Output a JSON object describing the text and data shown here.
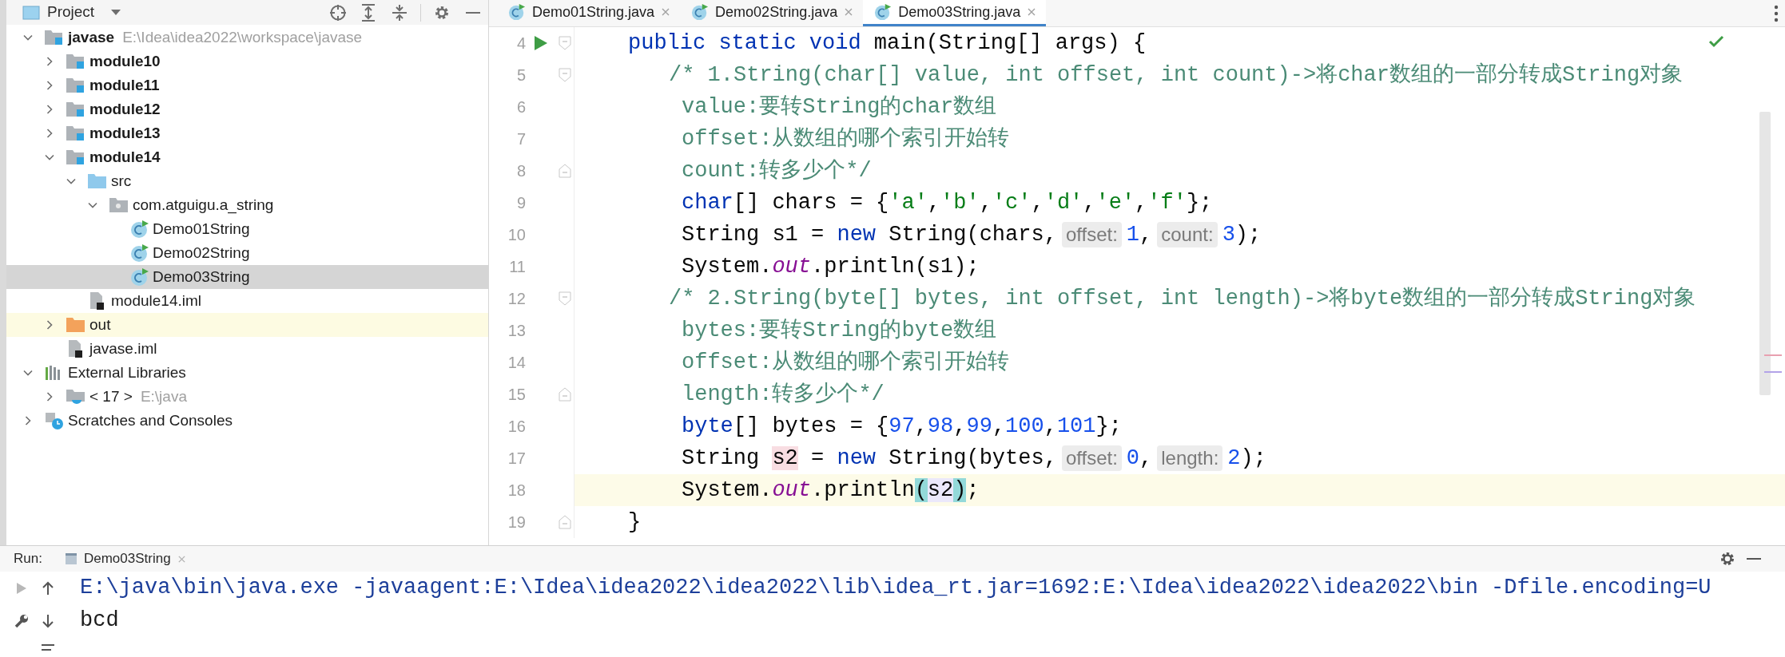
{
  "project": {
    "title": "Project",
    "tree": [
      {
        "label": "javase",
        "path": "E:\\Idea\\idea2022\\workspace\\javase",
        "kind": "module",
        "bold": true,
        "expanded": true,
        "selected": false,
        "ignored": false,
        "children": [
          {
            "label": "module10",
            "kind": "module",
            "bold": true,
            "expanded": false,
            "selected": false,
            "ignored": false
          },
          {
            "label": "module11",
            "kind": "module",
            "bold": true,
            "expanded": false,
            "selected": false,
            "ignored": false
          },
          {
            "label": "module12",
            "kind": "module",
            "bold": true,
            "expanded": false,
            "selected": false,
            "ignored": false
          },
          {
            "label": "module13",
            "kind": "module",
            "bold": true,
            "expanded": false,
            "selected": false,
            "ignored": false
          },
          {
            "label": "module14",
            "kind": "module",
            "bold": true,
            "expanded": true,
            "selected": false,
            "ignored": false,
            "children": [
              {
                "label": "src",
                "kind": "source",
                "bold": false,
                "expanded": true,
                "selected": false,
                "ignored": false,
                "children": [
                  {
                    "label": "com.atguigu.a_string",
                    "kind": "package",
                    "bold": false,
                    "expanded": true,
                    "selected": false,
                    "ignored": false,
                    "children": [
                      {
                        "label": "Demo01String",
                        "kind": "class",
                        "bold": false,
                        "selected": false,
                        "ignored": false
                      },
                      {
                        "label": "Demo02String",
                        "kind": "class",
                        "bold": false,
                        "selected": false,
                        "ignored": false
                      },
                      {
                        "label": "Demo03String",
                        "kind": "class",
                        "bold": false,
                        "selected": true,
                        "ignored": false
                      }
                    ]
                  }
                ]
              },
              {
                "label": "module14.iml",
                "kind": "iml",
                "bold": false,
                "selected": false,
                "ignored": false
              }
            ]
          },
          {
            "label": "out",
            "kind": "excluded",
            "bold": false,
            "expanded": false,
            "selected": false,
            "ignored": true
          },
          {
            "label": "javase.iml",
            "kind": "iml",
            "bold": false,
            "selected": false,
            "ignored": false
          }
        ]
      },
      {
        "label": "External Libraries",
        "kind": "libraries",
        "bold": false,
        "expanded": true,
        "selected": false,
        "ignored": false,
        "children": [
          {
            "label": "< 17 >",
            "path": "E:\\java",
            "kind": "sdk",
            "bold": false,
            "expanded": false,
            "selected": false,
            "ignored": false
          }
        ]
      },
      {
        "label": "Scratches and Consoles",
        "kind": "scratches",
        "bold": false,
        "expanded": false,
        "selected": false,
        "ignored": false
      }
    ]
  },
  "editor": {
    "tabs": [
      {
        "label": "Demo01String.java",
        "selected": false
      },
      {
        "label": "Demo02String.java",
        "selected": false
      },
      {
        "label": "Demo03String.java",
        "selected": true
      }
    ],
    "lines": [
      {
        "number": "4",
        "kind": "signature",
        "run": true,
        "fold_open": true,
        "fold_close": false,
        "current": false,
        "tokens": [
          {
            "kind": "keyword",
            "text": "public static void"
          },
          {
            "kind": "plain",
            "text": " main(String[] args) {"
          }
        ]
      },
      {
        "number": "5",
        "kind": "comment-open",
        "run": false,
        "fold_open": true,
        "fold_close": false,
        "current": false,
        "tokens": [
          {
            "kind": "comment",
            "text": "/* 1.String(char[] value, int offset, int count)->将char数组的一部分转成String对象"
          }
        ]
      },
      {
        "number": "6",
        "kind": "body",
        "run": false,
        "fold_open": false,
        "fold_close": false,
        "current": false,
        "tokens": [
          {
            "kind": "comment",
            "text": "value:要转String的char数组"
          }
        ]
      },
      {
        "number": "7",
        "kind": "body",
        "run": false,
        "fold_open": false,
        "fold_close": false,
        "current": false,
        "tokens": [
          {
            "kind": "comment",
            "text": "offset:从数组的哪个索引开始转"
          }
        ]
      },
      {
        "number": "8",
        "kind": "body",
        "run": false,
        "fold_open": false,
        "fold_close": true,
        "current": false,
        "tokens": [
          {
            "kind": "comment",
            "text": "count:转多少个*/"
          }
        ]
      },
      {
        "number": "9",
        "kind": "body",
        "run": false,
        "fold_open": false,
        "fold_close": false,
        "current": false,
        "tokens": [
          {
            "kind": "keyword",
            "text": "char"
          },
          {
            "kind": "plain",
            "text": "[] chars = {"
          },
          {
            "kind": "string",
            "text": "'a'"
          },
          {
            "kind": "plain",
            "text": ","
          },
          {
            "kind": "string",
            "text": "'b'"
          },
          {
            "kind": "plain",
            "text": ","
          },
          {
            "kind": "string",
            "text": "'c'"
          },
          {
            "kind": "plain",
            "text": ","
          },
          {
            "kind": "string",
            "text": "'d'"
          },
          {
            "kind": "plain",
            "text": ","
          },
          {
            "kind": "string",
            "text": "'e'"
          },
          {
            "kind": "plain",
            "text": ","
          },
          {
            "kind": "string",
            "text": "'f'"
          },
          {
            "kind": "plain",
            "text": "};"
          }
        ]
      },
      {
        "number": "10",
        "kind": "body",
        "run": false,
        "fold_open": false,
        "fold_close": false,
        "current": false,
        "tokens": [
          {
            "kind": "plain",
            "text": "String s1 = "
          },
          {
            "kind": "keyword",
            "text": "new"
          },
          {
            "kind": "plain",
            "text": " String(chars,"
          },
          {
            "kind": "hint",
            "text": "offset:"
          },
          {
            "kind": "number",
            "text": "1"
          },
          {
            "kind": "plain",
            "text": ","
          },
          {
            "kind": "hint",
            "text": "count:"
          },
          {
            "kind": "number",
            "text": "3"
          },
          {
            "kind": "plain",
            "text": ");"
          }
        ]
      },
      {
        "number": "11",
        "kind": "body",
        "run": false,
        "fold_open": false,
        "fold_close": false,
        "current": false,
        "tokens": [
          {
            "kind": "plain",
            "text": "System."
          },
          {
            "kind": "static",
            "text": "out"
          },
          {
            "kind": "plain",
            "text": ".println(s1);"
          }
        ]
      },
      {
        "number": "12",
        "kind": "comment-open",
        "run": false,
        "fold_open": true,
        "fold_close": false,
        "current": false,
        "tokens": [
          {
            "kind": "comment",
            "text": "/* 2.String(byte[] bytes, int offset, int length)->将byte数组的一部分转成String对象"
          }
        ]
      },
      {
        "number": "13",
        "kind": "body",
        "run": false,
        "fold_open": false,
        "fold_close": false,
        "current": false,
        "tokens": [
          {
            "kind": "comment",
            "text": "bytes:要转String的byte数组"
          }
        ]
      },
      {
        "number": "14",
        "kind": "body",
        "run": false,
        "fold_open": false,
        "fold_close": false,
        "current": false,
        "tokens": [
          {
            "kind": "comment",
            "text": "offset:从数组的哪个索引开始转"
          }
        ]
      },
      {
        "number": "15",
        "kind": "body",
        "run": false,
        "fold_open": false,
        "fold_close": true,
        "current": false,
        "tokens": [
          {
            "kind": "comment",
            "text": "length:转多少个*/"
          }
        ]
      },
      {
        "number": "16",
        "kind": "body",
        "run": false,
        "fold_open": false,
        "fold_close": false,
        "current": false,
        "tokens": [
          {
            "kind": "keyword",
            "text": "byte"
          },
          {
            "kind": "plain",
            "text": "[] bytes = {"
          },
          {
            "kind": "number",
            "text": "97"
          },
          {
            "kind": "plain",
            "text": ","
          },
          {
            "kind": "number",
            "text": "98"
          },
          {
            "kind": "plain",
            "text": ","
          },
          {
            "kind": "number",
            "text": "99"
          },
          {
            "kind": "plain",
            "text": ","
          },
          {
            "kind": "number",
            "text": "100"
          },
          {
            "kind": "plain",
            "text": ","
          },
          {
            "kind": "number",
            "text": "101"
          },
          {
            "kind": "plain",
            "text": "};"
          }
        ]
      },
      {
        "number": "17",
        "kind": "body",
        "run": false,
        "fold_open": false,
        "fold_close": false,
        "current": false,
        "tokens": [
          {
            "kind": "plain",
            "text": "String "
          },
          {
            "kind": "write",
            "text": "s2"
          },
          {
            "kind": "plain",
            "text": " = "
          },
          {
            "kind": "keyword",
            "text": "new"
          },
          {
            "kind": "plain",
            "text": " String(bytes,"
          },
          {
            "kind": "hint",
            "text": "offset:"
          },
          {
            "kind": "number",
            "text": "0"
          },
          {
            "kind": "plain",
            "text": ","
          },
          {
            "kind": "hint",
            "text": "length:"
          },
          {
            "kind": "number",
            "text": "2"
          },
          {
            "kind": "plain",
            "text": ");"
          }
        ]
      },
      {
        "number": "18",
        "kind": "body",
        "run": false,
        "fold_open": false,
        "fold_close": false,
        "current": true,
        "tokens": [
          {
            "kind": "plain",
            "text": "System."
          },
          {
            "kind": "static",
            "text": "out"
          },
          {
            "kind": "plain",
            "text": ".println"
          },
          {
            "kind": "match",
            "text": "("
          },
          {
            "kind": "read",
            "text": "s2"
          },
          {
            "kind": "match",
            "text": ")"
          },
          {
            "kind": "plain",
            "text": ";"
          }
        ]
      },
      {
        "number": "19",
        "kind": "signature",
        "run": false,
        "fold_open": false,
        "fold_close": true,
        "current": false,
        "tokens": [
          {
            "kind": "plain",
            "text": "}"
          }
        ]
      }
    ]
  },
  "run": {
    "label": "Run:",
    "tab": "Demo03String",
    "console": [
      {
        "kind": "command",
        "text": "E:\\java\\bin\\java.exe -javaagent:E:\\Idea\\idea2022\\idea2022\\lib\\idea_rt.jar=1692:E:\\Idea\\idea2022\\idea2022\\bin -Dfile.encoding=U"
      },
      {
        "kind": "output",
        "text": "bcd"
      }
    ]
  }
}
